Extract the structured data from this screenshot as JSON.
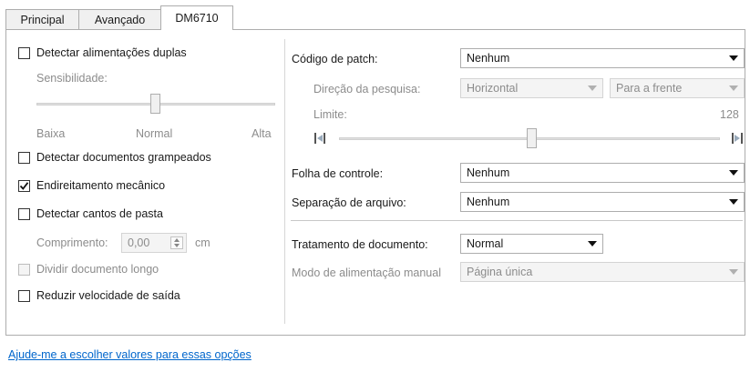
{
  "tabs": [
    {
      "label": "Principal"
    },
    {
      "label": "Avançado"
    },
    {
      "label": "DM6710"
    }
  ],
  "left": {
    "double_feed": {
      "label": "Detectar alimentações duplas",
      "checked": false
    },
    "sensitivity": {
      "label": "Sensibilidade:",
      "min_label": "Baixa",
      "mid_label": "Normal",
      "max_label": "Alta",
      "level": 0.5
    },
    "stapled": {
      "label": "Detectar documentos grampeados",
      "checked": false
    },
    "deskew": {
      "label": "Endireitamento mecânico",
      "checked": true
    },
    "folder_corners": {
      "label": "Detectar cantos de pasta",
      "checked": false
    },
    "length": {
      "label": "Comprimento:",
      "value": "0,00",
      "unit": "cm"
    },
    "split_long": {
      "label": "Dividir documento longo",
      "checked": false
    },
    "reduce_speed": {
      "label": "Reduzir velocidade de saída",
      "checked": false
    }
  },
  "right": {
    "patch_code": {
      "label": "Código de patch:",
      "value": "Nenhum"
    },
    "search_direction": {
      "label": "Direção da pesquisa:",
      "value1": "Horizontal",
      "value2": "Para a frente"
    },
    "limit": {
      "label": "Limite:",
      "value": "128",
      "level": 0.5
    },
    "control_sheet": {
      "label": "Folha de controle:",
      "value": "Nenhum"
    },
    "file_separation": {
      "label": "Separação de arquivo:",
      "value": "Nenhum"
    },
    "doc_treatment": {
      "label": "Tratamento de documento:",
      "value": "Normal"
    },
    "manual_feed": {
      "label": "Modo de alimentação manual",
      "value": "Página única"
    }
  },
  "help_link": "Ajude-me a escolher valores para essas opções",
  "colors": {
    "link": "#0066cc",
    "border": "#adadad",
    "disabled_text": "#8c8c8c"
  }
}
